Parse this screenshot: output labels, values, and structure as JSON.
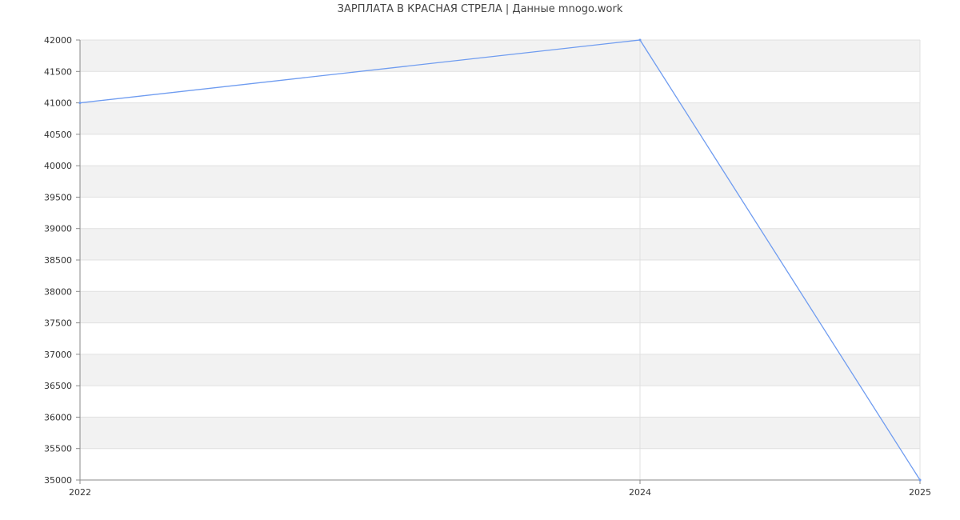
{
  "chart_data": {
    "type": "line",
    "title": "ЗАРПЛАТА В КРАСНАЯ СТРЕЛА | Данные mnogo.work",
    "xlabel": "",
    "ylabel": "",
    "x": [
      "2022",
      "2024",
      "2025"
    ],
    "series": [
      {
        "values": [
          41000,
          42000,
          35000
        ]
      }
    ],
    "ylim": [
      35000,
      42000
    ],
    "yticks": [
      42000,
      41500,
      41000,
      40500,
      40000,
      39500,
      39000,
      38500,
      38000,
      37500,
      37000,
      36500,
      36000,
      35500,
      35000
    ],
    "grid": true,
    "legend": "none",
    "colors": {
      "line": "#6f9cf0",
      "band": "#f2f2f2",
      "grid": "#e0e0e0",
      "axis": "#888888"
    }
  }
}
